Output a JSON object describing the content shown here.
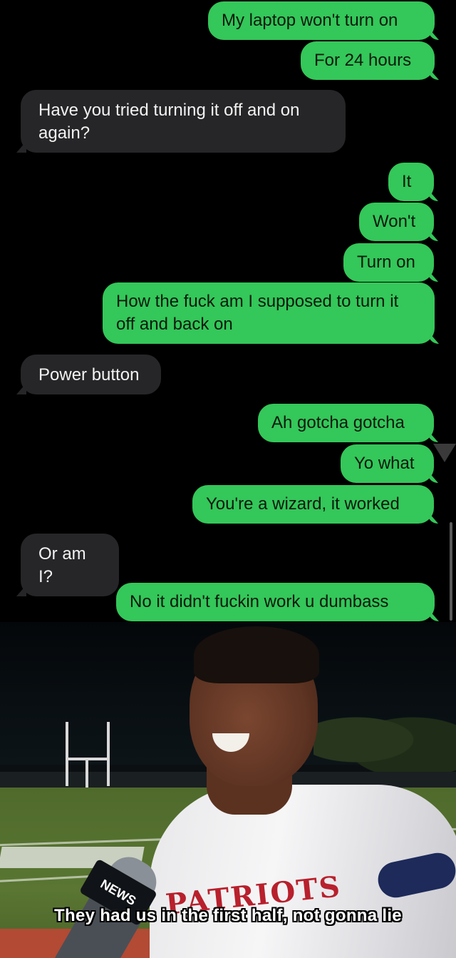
{
  "conversation": {
    "messages": [
      {
        "id": "m1",
        "sender": "me",
        "text": "My laptop won't turn on"
      },
      {
        "id": "m2",
        "sender": "me",
        "text": "For 24 hours"
      },
      {
        "id": "m3",
        "sender": "them",
        "text": "Have you tried turning it off and on again?"
      },
      {
        "id": "m4",
        "sender": "me",
        "text": "It"
      },
      {
        "id": "m5",
        "sender": "me",
        "text": "Won't"
      },
      {
        "id": "m6",
        "sender": "me",
        "text": "Turn on"
      },
      {
        "id": "m7",
        "sender": "me",
        "text": "How the fuck am I supposed to turn it off and back on"
      },
      {
        "id": "m8",
        "sender": "them",
        "text": "Power button"
      },
      {
        "id": "m9",
        "sender": "me",
        "text": "Ah gotcha gotcha"
      },
      {
        "id": "m10",
        "sender": "me",
        "text": "Yo what"
      },
      {
        "id": "m11",
        "sender": "me",
        "text": "You're a wizard, it worked"
      },
      {
        "id": "m12",
        "sender": "them",
        "text": "Or am I?"
      },
      {
        "id": "m13",
        "sender": "me",
        "text": "No it didn't fuckin work u dumbass"
      }
    ]
  },
  "meme": {
    "caption": "They had us in the first half, not gonna lie",
    "mic_flag_text": "NEWS",
    "jersey_text": "PATRIOTS"
  },
  "colors": {
    "outgoing_bubble": "#34c759",
    "incoming_bubble": "#262628",
    "background": "#000000"
  },
  "icons": {
    "scroll_arrow": "triangle-down-icon"
  }
}
